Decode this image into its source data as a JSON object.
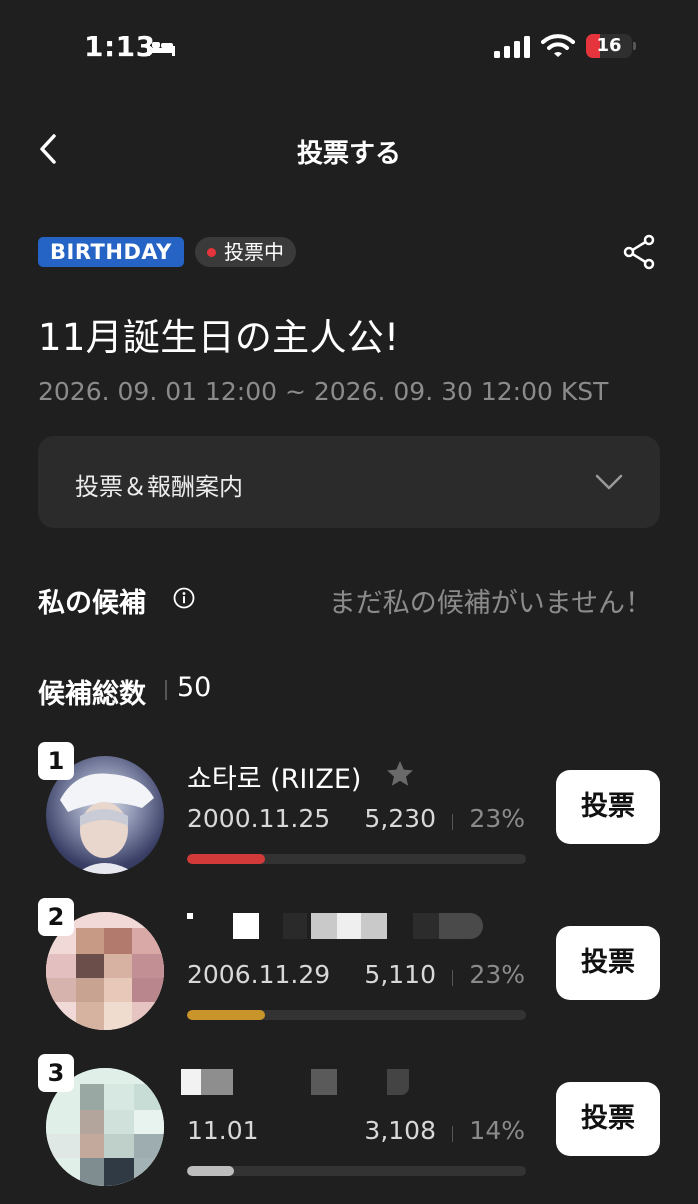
{
  "status_bar": {
    "time": "1:13",
    "battery": "16"
  },
  "nav": {
    "title": "投票する"
  },
  "event": {
    "category_badge": "BIRTHDAY",
    "status_badge": "投票中",
    "title": "11月誕生日の主人公!",
    "period": "2026. 09. 01 12:00 ~ 2026. 09. 30 12:00 KST"
  },
  "guide": {
    "label": "投票＆報酬案内"
  },
  "my_candidate": {
    "label": "私の候補",
    "empty_text": "まだ私の候補がいません！"
  },
  "totals": {
    "label": "候補総数",
    "value": "50"
  },
  "candidates": [
    {
      "rank": "1",
      "name": "쇼타로 (RIIZE)",
      "date": "2000.11.25",
      "votes": "5,230",
      "percent": "23%",
      "fill_fraction": 0.23,
      "bar_color": "#d23a3a",
      "vote_label": "投票"
    },
    {
      "rank": "2",
      "name": "",
      "date": "2006.11.29",
      "votes": "5,110",
      "percent": "23%",
      "fill_fraction": 0.23,
      "bar_color": "#c9952a",
      "vote_label": "投票"
    },
    {
      "rank": "3",
      "name": "",
      "date": "11.01",
      "votes": "3,108",
      "percent": "14%",
      "fill_fraction": 0.14,
      "bar_color": "#bdbdbd",
      "vote_label": "投票"
    }
  ],
  "colors": {
    "background": "#1f1f1f",
    "accent_blue": "#2563c4",
    "live_red": "#e5343b"
  },
  "icons": [
    "bed-icon",
    "signal-icon",
    "wifi-icon",
    "back-icon",
    "share-icon",
    "chevron-down-icon",
    "info-icon",
    "star-icon"
  ]
}
